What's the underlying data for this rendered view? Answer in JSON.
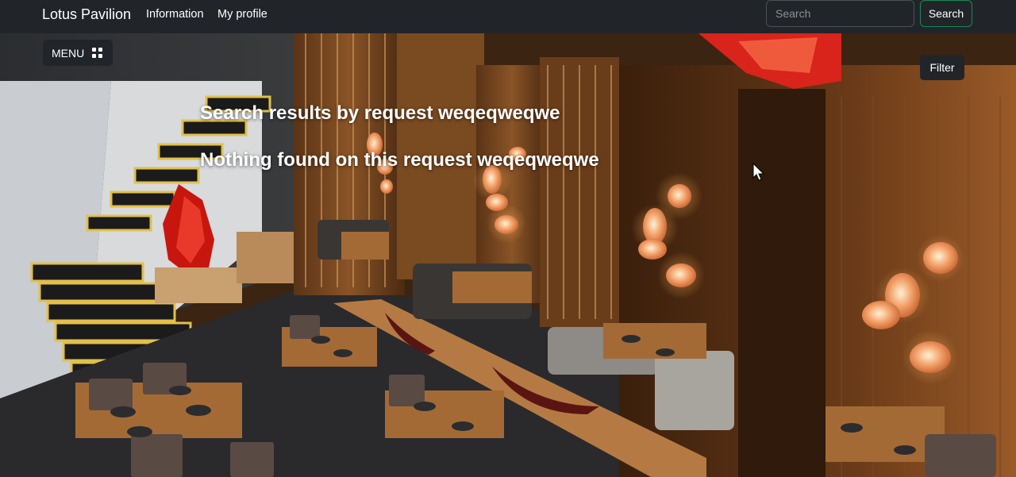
{
  "navbar": {
    "brand": "Lotus Pavilion",
    "links": [
      "Information",
      "My profile"
    ],
    "search_placeholder": "Search",
    "search_button": "Search"
  },
  "controls": {
    "menu_label": "MENU",
    "menu_icon": "grid-icon",
    "filter_label": "Filter"
  },
  "results": {
    "title": "Search results by request weqeqweqwe",
    "empty_message": "Nothing found on this request weqeqweqwe"
  },
  "colors": {
    "navbar_bg": "#212529",
    "search_button_border": "#198754",
    "button_bg": "#212529"
  }
}
